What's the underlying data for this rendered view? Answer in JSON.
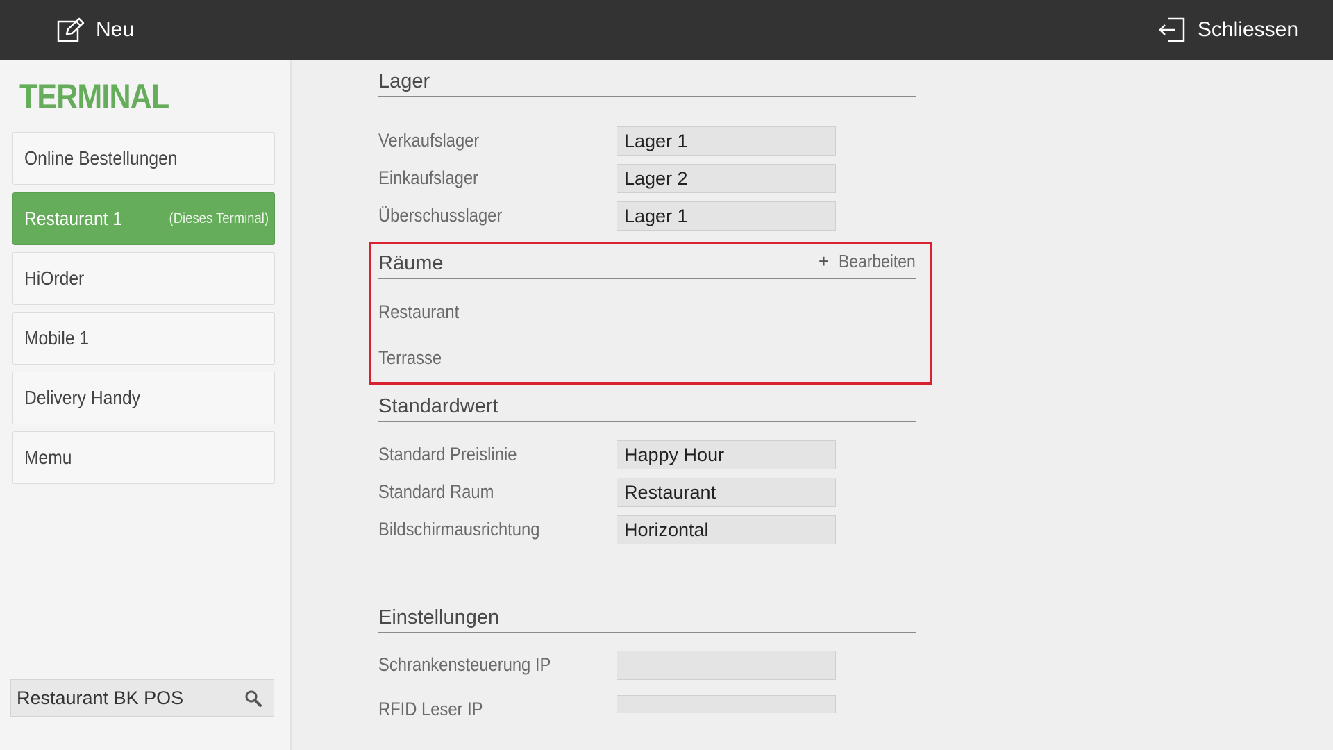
{
  "topbar": {
    "new_label": "Neu",
    "close_label": "Schliessen"
  },
  "sidebar": {
    "title": "TERMINAL",
    "items": [
      {
        "label": "Online Bestellungen",
        "sub": ""
      },
      {
        "label": "Restaurant 1",
        "sub": "(Dieses Terminal)",
        "active": true
      },
      {
        "label": "HiOrder",
        "sub": ""
      },
      {
        "label": "Mobile 1",
        "sub": ""
      },
      {
        "label": "Delivery Handy",
        "sub": ""
      },
      {
        "label": "Memu",
        "sub": ""
      }
    ],
    "search_value": "Restaurant BK POS"
  },
  "lager": {
    "heading": "Lager",
    "rows": [
      {
        "label": "Verkaufslager",
        "value": "Lager 1"
      },
      {
        "label": "Einkaufslager",
        "value": "Lager 2"
      },
      {
        "label": "Überschusslager",
        "value": "Lager 1"
      }
    ]
  },
  "raeume": {
    "heading": "Räume",
    "add_symbol": "+",
    "edit_label": "Bearbeiten",
    "items": [
      "Restaurant",
      "Terrasse"
    ]
  },
  "standardwert": {
    "heading": "Standardwert",
    "rows": [
      {
        "label": "Standard Preislinie",
        "value": "Happy Hour"
      },
      {
        "label": "Standard Raum",
        "value": "Restaurant"
      },
      {
        "label": "Bildschirmausrichtung",
        "value": "Horizontal"
      }
    ]
  },
  "einstellungen": {
    "heading": "Einstellungen",
    "rows": [
      {
        "label": "Schrankensteuerung IP",
        "value": ""
      },
      {
        "label": "RFID Leser IP",
        "value": ""
      }
    ]
  },
  "colors": {
    "accent": "#66ad5b",
    "topbar": "#333333",
    "highlight": "#d8222f"
  }
}
